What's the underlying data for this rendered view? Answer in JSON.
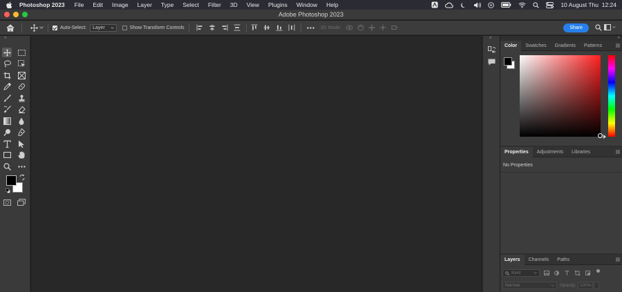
{
  "menubar": {
    "app_name": "Photoshop 2023",
    "items": [
      "File",
      "Edit",
      "Image",
      "Layer",
      "Type",
      "Select",
      "Filter",
      "3D",
      "View",
      "Plugins",
      "Window",
      "Help"
    ],
    "datetime": "10 August Thu  12:24"
  },
  "window": {
    "title": "Adobe Photoshop 2023"
  },
  "options": {
    "auto_select_label": "Auto-Select:",
    "auto_select_checked": true,
    "auto_select_target": "Layer",
    "transform_label": "Show Transform Controls",
    "transform_checked": false,
    "mode_3d_label": "3D Mode:",
    "share_label": "Share"
  },
  "panels": {
    "color": {
      "tabs": [
        "Color",
        "Swatches",
        "Gradients",
        "Patterns"
      ],
      "active": "Color"
    },
    "properties": {
      "tabs": [
        "Properties",
        "Adjustments",
        "Libraries"
      ],
      "active": "Properties",
      "empty_text": "No Properties"
    },
    "layers": {
      "tabs": [
        "Layers",
        "Channels",
        "Paths"
      ],
      "active": "Layers",
      "filter_placeholder": "Kind",
      "blend_mode": "Normal",
      "opacity_label": "Opacity:",
      "opacity_value": "100%"
    }
  },
  "colors": {
    "share_button": "#2680eb",
    "foreground": "#000000",
    "background": "#ffffff",
    "color_field_hue": "#ff2020"
  }
}
